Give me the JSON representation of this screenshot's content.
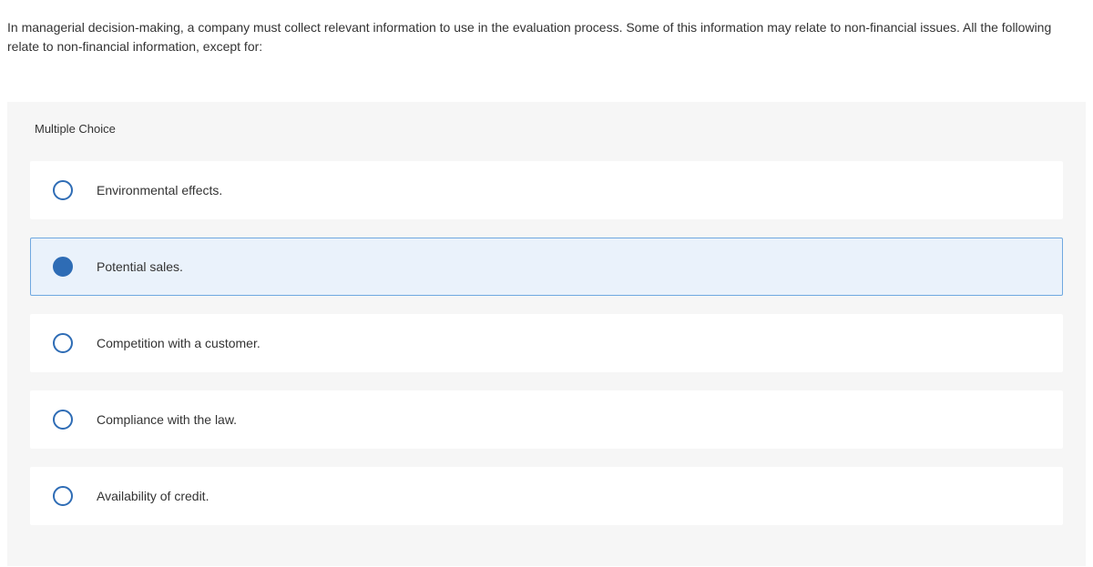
{
  "question": {
    "stem": "In managerial decision-making, a company must collect relevant information to use in the evaluation process. Some of this information may relate to non-financial issues. All the following relate to non-financial information, except for:"
  },
  "quiz": {
    "type_label": "Multiple Choice",
    "options": [
      {
        "label": "Environmental effects.",
        "selected": false
      },
      {
        "label": "Potential sales.",
        "selected": true
      },
      {
        "label": "Competition with a customer.",
        "selected": false
      },
      {
        "label": "Compliance with the law.",
        "selected": false
      },
      {
        "label": "Availability of credit.",
        "selected": false
      }
    ]
  }
}
